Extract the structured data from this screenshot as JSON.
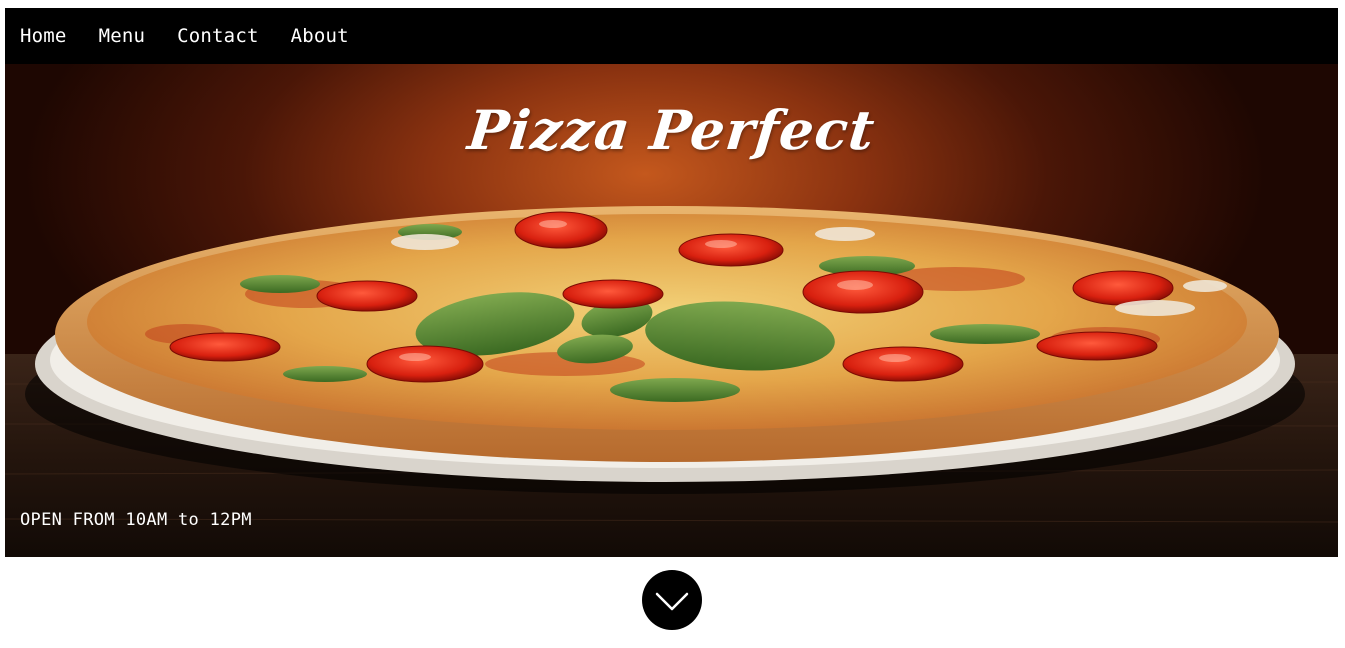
{
  "nav": {
    "items": [
      {
        "label": "Home"
      },
      {
        "label": "Menu"
      },
      {
        "label": "Contact"
      },
      {
        "label": "About"
      }
    ]
  },
  "hero": {
    "title": "Pizza Perfect",
    "hours": "OPEN FROM 10AM to 12PM",
    "image": "pizza-photo"
  },
  "scroll_button": {
    "icon": "chevron-down-icon"
  },
  "colors": {
    "nav_background": "#000000",
    "text": "#ffffff",
    "hero_glow": "#c4581d"
  }
}
